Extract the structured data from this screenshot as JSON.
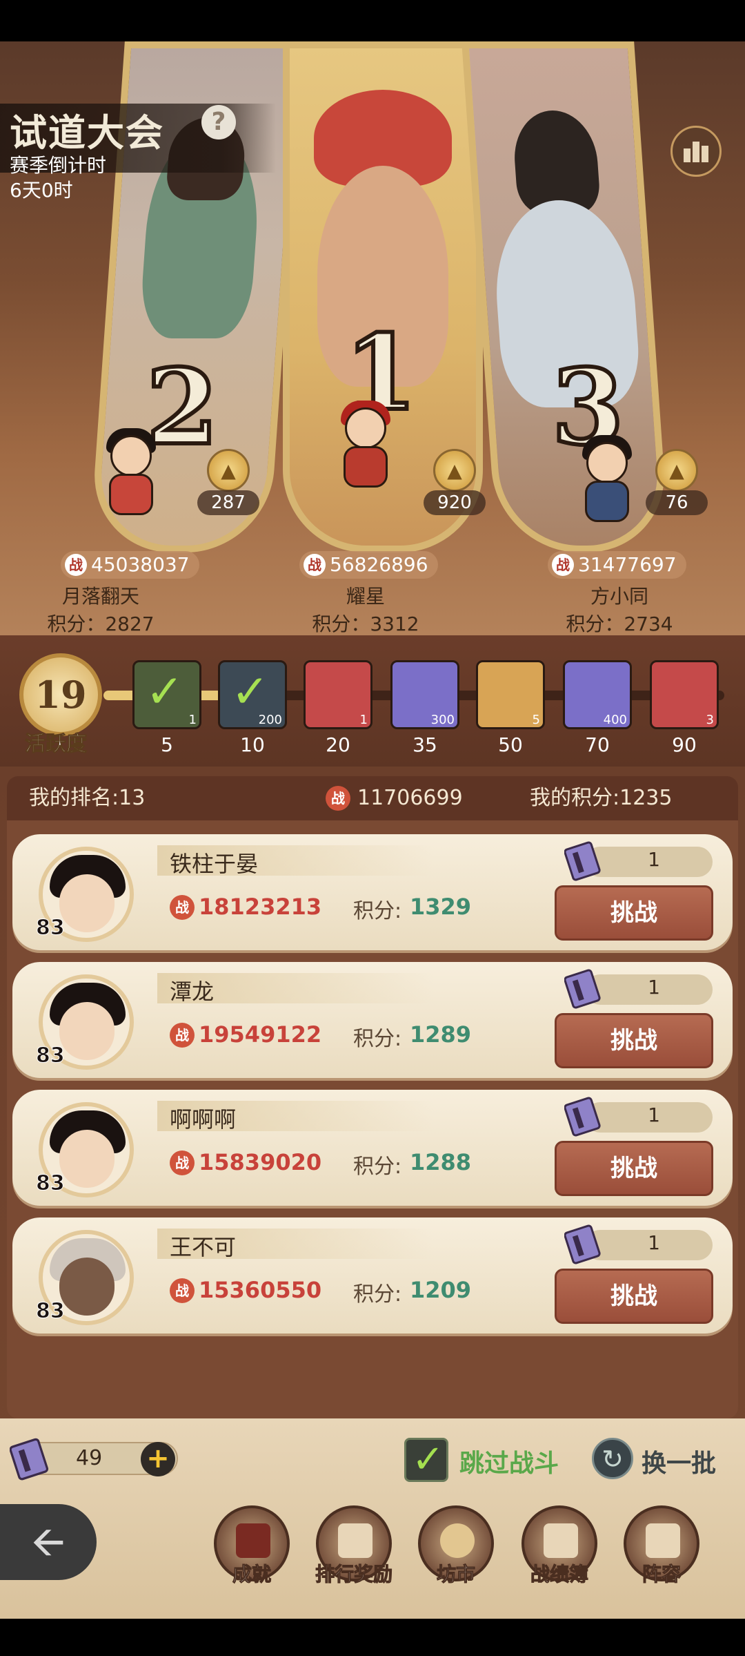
{
  "header": {
    "title": "试道大会",
    "help": "?",
    "countdown_label": "赛季倒计时",
    "countdown_value": "6天0时"
  },
  "podium": [
    {
      "rank": "2",
      "likes": "287",
      "power": "45038037",
      "name": "月落翻天",
      "score": "积分：2827"
    },
    {
      "rank": "1",
      "likes": "920",
      "power": "56826896",
      "name": "耀星",
      "score": "积分：3312"
    },
    {
      "rank": "3",
      "likes": "76",
      "power": "31477697",
      "name": "方小同",
      "score": "积分：2734"
    }
  ],
  "zhan": "战",
  "activity": {
    "value": "19",
    "label": "活跃度",
    "progress_fraction": 0.22,
    "rewards": [
      {
        "threshold": "5",
        "qty": "1",
        "claimed": true,
        "color": "#4d5d3a"
      },
      {
        "threshold": "10",
        "qty": "200",
        "claimed": true,
        "color": "#3d4a55"
      },
      {
        "threshold": "20",
        "qty": "1",
        "claimed": false,
        "color": "#c54a4a"
      },
      {
        "threshold": "35",
        "qty": "300",
        "claimed": false,
        "color": "#7b6fc8"
      },
      {
        "threshold": "50",
        "qty": "5",
        "claimed": false,
        "color": "#d8a455"
      },
      {
        "threshold": "70",
        "qty": "400",
        "claimed": false,
        "color": "#7b6fc8"
      },
      {
        "threshold": "90",
        "qty": "3",
        "claimed": false,
        "color": "#c54a4a"
      }
    ]
  },
  "my": {
    "rank": "我的排名:13",
    "power": "11706699",
    "score": "我的积分:1235"
  },
  "opponents": [
    {
      "level": "83",
      "name": "铁柱于晏",
      "power": "18123213",
      "score_label": "积分:",
      "score": "1329",
      "tickets": "1",
      "challenge": "挑战"
    },
    {
      "level": "83",
      "name": "潭龙",
      "power": "19549122",
      "score_label": "积分:",
      "score": "1289",
      "tickets": "1",
      "challenge": "挑战"
    },
    {
      "level": "83",
      "name": "啊啊啊",
      "power": "15839020",
      "score_label": "积分:",
      "score": "1288",
      "tickets": "1",
      "challenge": "挑战"
    },
    {
      "level": "83",
      "name": "王不可",
      "power": "15360550",
      "score_label": "积分:",
      "score": "1209",
      "tickets": "1",
      "challenge": "挑战"
    }
  ],
  "footer": {
    "tickets": "49",
    "plus": "+",
    "skip": "跳过战斗",
    "refresh": "换一批",
    "nav": [
      {
        "label": "成就",
        "icon": "scroll-banner-icon"
      },
      {
        "label": "排行奖励",
        "icon": "ranking-bars-icon"
      },
      {
        "label": "坊市",
        "icon": "money-bag-icon"
      },
      {
        "label": "战绩簿",
        "icon": "record-scroll-icon"
      },
      {
        "label": "阵容",
        "icon": "formation-icon"
      }
    ]
  }
}
